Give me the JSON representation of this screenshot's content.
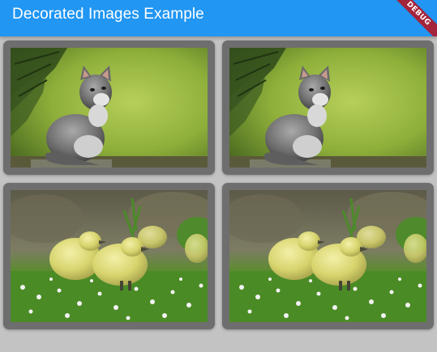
{
  "appbar": {
    "title": "Decorated Images Example",
    "color": "#2196f3"
  },
  "debug_banner": {
    "label": "DEBUG",
    "color": "#a3243b"
  },
  "images": [
    {
      "name": "kitten-photo",
      "subject": "kitten"
    },
    {
      "name": "kitten-photo",
      "subject": "kitten"
    },
    {
      "name": "goslings-photo",
      "subject": "goslings"
    },
    {
      "name": "goslings-photo",
      "subject": "goslings"
    }
  ]
}
